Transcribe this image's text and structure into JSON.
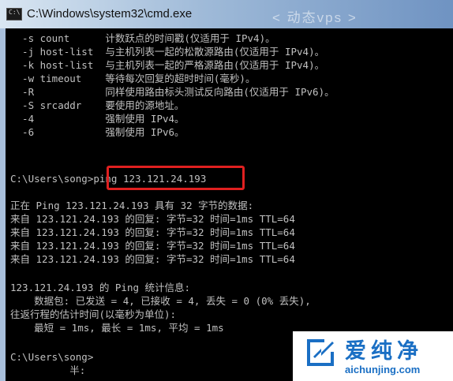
{
  "window": {
    "title": "C:\\Windows\\system32\\cmd.exe",
    "title_watermark": "< 动态vps >"
  },
  "console": {
    "lines": [
      "  -s count      计数跃点的时间戳(仅适用于 IPv4)。",
      "  -j host-list  与主机列表一起的松散源路由(仅适用于 IPv4)。",
      "  -k host-list  与主机列表一起的严格源路由(仅适用于 IPv4)。",
      "  -w timeout    等待每次回复的超时时间(毫秒)。",
      "  -R            同样使用路由标头测试反向路由(仅适用于 IPv6)。",
      "  -S srcaddr    要使用的源地址。",
      "  -4            强制使用 IPv4。",
      "  -6            强制使用 IPv6。",
      "",
      "",
      "C:\\Users\\song>ping 123.121.24.193",
      "",
      "正在 Ping 123.121.24.193 具有 32 字节的数据:",
      "来自 123.121.24.193 的回复: 字节=32 时间=1ms TTL=64",
      "来自 123.121.24.193 的回复: 字节=32 时间=1ms TTL=64",
      "来自 123.121.24.193 的回复: 字节=32 时间=1ms TTL=64",
      "来自 123.121.24.193 的回复: 字节=32 时间=1ms TTL=64",
      "",
      "123.121.24.193 的 Ping 统计信息:",
      "    数据包: 已发送 = 4, 已接收 = 4, 丢失 = 0 (0% 丢失),",
      "往返行程的估计时间(以毫秒为单位):",
      "    最短 = 1ms, 最长 = 1ms, 平均 = 1ms",
      "",
      "C:\\Users\\song>",
      "          半:"
    ]
  },
  "watermark": {
    "brand": "爱纯净",
    "url": "aichunjing.com"
  },
  "colors": {
    "console_bg": "#000000",
    "console_text": "#c0c0c0",
    "highlight": "#e02020",
    "brand": "#1a6fc4"
  }
}
